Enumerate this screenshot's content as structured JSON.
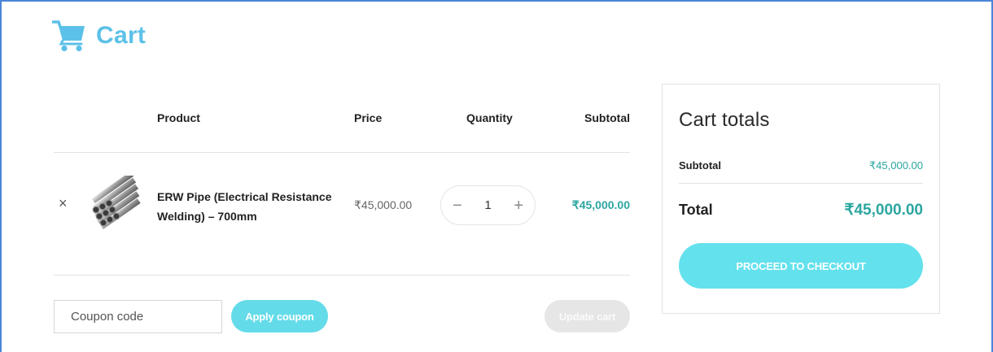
{
  "page": {
    "title": "Cart",
    "icon": "shopping-cart-icon",
    "accent_color": "#5cc1e8"
  },
  "cart_table": {
    "headers": {
      "product": "Product",
      "price": "Price",
      "quantity": "Quantity",
      "subtotal": "Subtotal"
    },
    "items": [
      {
        "remove_glyph": "×",
        "thumbnail": "steel-pipes-thumbnail",
        "name": "ERW Pipe (Electrical Resistance Welding) – 700mm",
        "price": "₹45,000.00",
        "quantity": "1",
        "subtotal": "₹45,000.00"
      }
    ],
    "qty_minus": "−",
    "qty_plus": "+",
    "price_color": "#2ba6a0"
  },
  "actions": {
    "coupon_placeholder": "Coupon code",
    "apply_label": "Apply coupon",
    "update_label": "Update cart",
    "button_color": "#63dbe9"
  },
  "totals": {
    "title": "Cart totals",
    "subtotal_label": "Subtotal",
    "subtotal_value": "₹45,000.00",
    "total_label": "Total",
    "total_value": "₹45,000.00",
    "checkout_label": "PROCEED TO CHECKOUT"
  }
}
